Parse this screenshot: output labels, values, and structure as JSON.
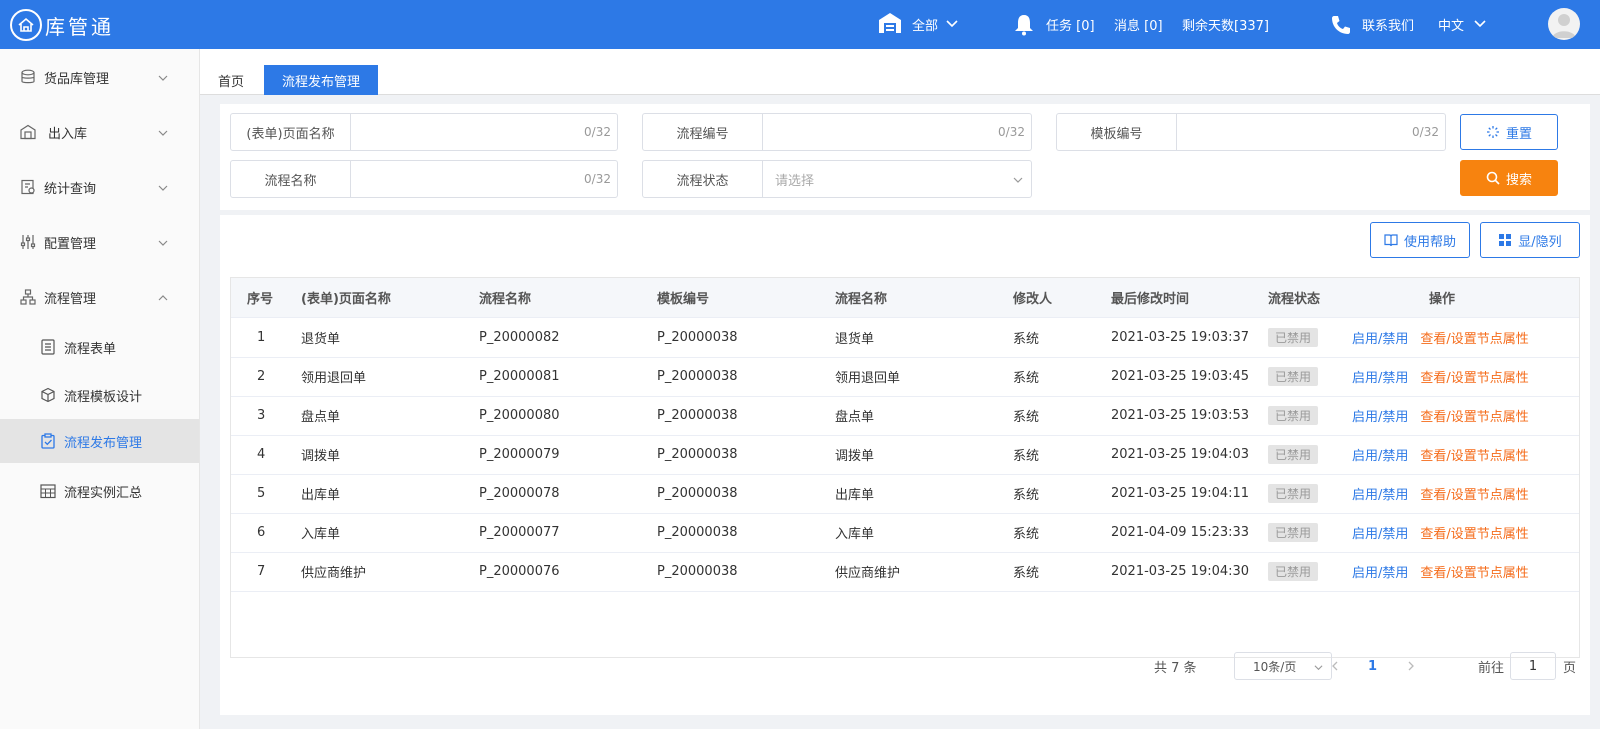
{
  "app": {
    "title": "库管通"
  },
  "header": {
    "scope_label": "全部",
    "task_label": "任务 [0]",
    "message_label": "消息 [0]",
    "days_label": "剩余天数[337]",
    "contact_label": "联系我们",
    "language_label": "中文"
  },
  "sidebar": {
    "groups": [
      {
        "label": "货品库管理",
        "icon": "database-icon"
      },
      {
        "label": "出入库",
        "icon": "warehouse-icon"
      },
      {
        "label": "统计查询",
        "icon": "report-icon"
      },
      {
        "label": "配置管理",
        "icon": "sliders-icon"
      },
      {
        "label": "流程管理",
        "icon": "flow-icon"
      }
    ],
    "sub_items": [
      {
        "label": "流程表单",
        "icon": "form-icon"
      },
      {
        "label": "流程模板设计",
        "icon": "cube-icon"
      },
      {
        "label": "流程发布管理",
        "icon": "clipboard-check-icon"
      },
      {
        "label": "流程实例汇总",
        "icon": "calendar-grid-icon"
      }
    ]
  },
  "tabs": {
    "home": "首页",
    "active": "流程发布管理"
  },
  "filters": {
    "page_name": {
      "label": "(表单)页面名称",
      "count": "0/32",
      "value": ""
    },
    "flow_code": {
      "label": "流程编号",
      "count": "0/32",
      "value": ""
    },
    "template_code": {
      "label": "模板编号",
      "count": "0/32",
      "value": ""
    },
    "flow_name": {
      "label": "流程名称",
      "count": "0/32",
      "value": ""
    },
    "flow_status": {
      "label": "流程状态",
      "placeholder": "请选择"
    },
    "reset_label": "重置",
    "search_label": "搜索"
  },
  "toolbar": {
    "help_label": "使用帮助",
    "columns_label": "显/隐列"
  },
  "table": {
    "columns": [
      "序号",
      "(表单)页面名称",
      "流程名称",
      "模板编号",
      "流程名称",
      "修改人",
      "最后修改时间",
      "流程状态",
      "操作"
    ],
    "rows": [
      {
        "no": "1",
        "page_name": "退货单",
        "flow_code": "P_20000082",
        "template": "P_20000038",
        "flow_name": "退货单",
        "modifier": "系统",
        "time": "2021-03-25 19:03:37",
        "status": "已禁用",
        "action1": "启用/禁用",
        "action2": "查看/设置节点属性"
      },
      {
        "no": "2",
        "page_name": "领用退回单",
        "flow_code": "P_20000081",
        "template": "P_20000038",
        "flow_name": "领用退回单",
        "modifier": "系统",
        "time": "2021-03-25 19:03:45",
        "status": "已禁用",
        "action1": "启用/禁用",
        "action2": "查看/设置节点属性"
      },
      {
        "no": "3",
        "page_name": "盘点单",
        "flow_code": "P_20000080",
        "template": "P_20000038",
        "flow_name": "盘点单",
        "modifier": "系统",
        "time": "2021-03-25 19:03:53",
        "status": "已禁用",
        "action1": "启用/禁用",
        "action2": "查看/设置节点属性"
      },
      {
        "no": "4",
        "page_name": "调拨单",
        "flow_code": "P_20000079",
        "template": "P_20000038",
        "flow_name": "调拨单",
        "modifier": "系统",
        "time": "2021-03-25 19:04:03",
        "status": "已禁用",
        "action1": "启用/禁用",
        "action2": "查看/设置节点属性"
      },
      {
        "no": "5",
        "page_name": "出库单",
        "flow_code": "P_20000078",
        "template": "P_20000038",
        "flow_name": "出库单",
        "modifier": "系统",
        "time": "2021-03-25 19:04:11",
        "status": "已禁用",
        "action1": "启用/禁用",
        "action2": "查看/设置节点属性"
      },
      {
        "no": "6",
        "page_name": "入库单",
        "flow_code": "P_20000077",
        "template": "P_20000038",
        "flow_name": "入库单",
        "modifier": "系统",
        "time": "2021-04-09 15:23:33",
        "status": "已禁用",
        "action1": "启用/禁用",
        "action2": "查看/设置节点属性"
      },
      {
        "no": "7",
        "page_name": "供应商维护",
        "flow_code": "P_20000076",
        "template": "P_20000038",
        "flow_name": "供应商维护",
        "modifier": "系统",
        "time": "2021-03-25 19:04:30",
        "status": "已禁用",
        "action1": "启用/禁用",
        "action2": "查看/设置节点属性"
      }
    ]
  },
  "pagination": {
    "total_label": "共 7 条",
    "page_size": "10条/页",
    "current_page": "1",
    "goto_label": "前往",
    "goto_value": "1",
    "page_unit": "页"
  },
  "colors": {
    "primary": "#2d79e6",
    "accent_orange": "#f7830f",
    "link_orange": "#f56c1b"
  }
}
